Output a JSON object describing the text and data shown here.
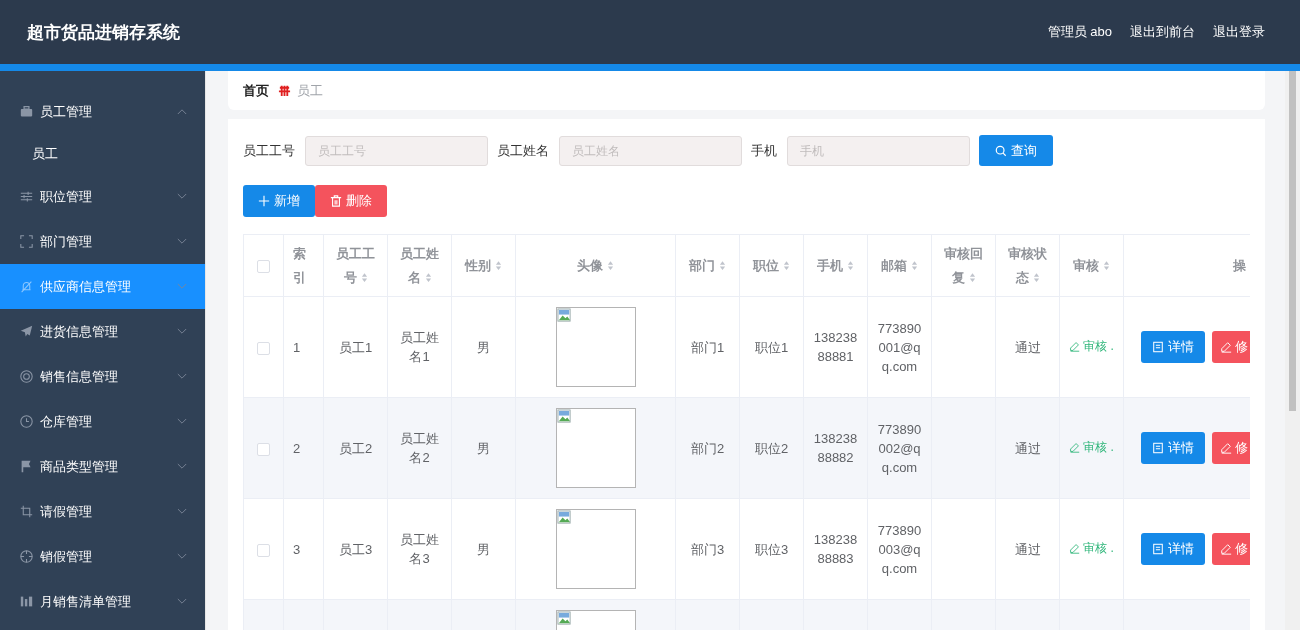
{
  "app_title": "超市货品进销存系统",
  "header_links": [
    "管理员 abo",
    "退出到前台",
    "退出登录"
  ],
  "sidebar": {
    "items": [
      {
        "label": "员工管理",
        "expanded": true,
        "selected": false,
        "children": [
          {
            "label": "员工",
            "selected": false
          }
        ]
      },
      {
        "label": "职位管理",
        "expanded": false,
        "selected": false
      },
      {
        "label": "部门管理",
        "expanded": false,
        "selected": false
      },
      {
        "label": "供应商信息管理",
        "expanded": false,
        "selected": true
      },
      {
        "label": "进货信息管理",
        "expanded": false,
        "selected": false
      },
      {
        "label": "销售信息管理",
        "expanded": false,
        "selected": false
      },
      {
        "label": "仓库管理",
        "expanded": false,
        "selected": false
      },
      {
        "label": "商品类型管理",
        "expanded": false,
        "selected": false
      },
      {
        "label": "请假管理",
        "expanded": false,
        "selected": false
      },
      {
        "label": "销假管理",
        "expanded": false,
        "selected": false
      },
      {
        "label": "月销售清单管理",
        "expanded": false,
        "selected": false
      }
    ]
  },
  "breadcrumb": [
    "首页",
    "员工"
  ],
  "search": {
    "fields": [
      {
        "label": "员工工号",
        "placeholder": "员工工号"
      },
      {
        "label": "员工姓名",
        "placeholder": "员工姓名"
      },
      {
        "label": "手机",
        "placeholder": "手机"
      }
    ],
    "button": "查询"
  },
  "actions": [
    {
      "kind": "add",
      "label": "新增"
    },
    {
      "kind": "delete",
      "label": "删除"
    }
  ],
  "table": {
    "header_checked": false,
    "columns": [
      {
        "label": "索引",
        "sortable": false
      },
      {
        "label": "员工工号",
        "sortable": true
      },
      {
        "label": "员工姓名",
        "sortable": true
      },
      {
        "label": "性别",
        "sortable": true
      },
      {
        "label": "头像",
        "sortable": true
      },
      {
        "label": "部门",
        "sortable": true
      },
      {
        "label": "职位",
        "sortable": true
      },
      {
        "label": "手机",
        "sortable": true
      },
      {
        "label": "邮箱",
        "sortable": true
      },
      {
        "label": "审核回复",
        "sortable": true
      },
      {
        "label": "审核状态",
        "sortable": true
      },
      {
        "label": "审核",
        "sortable": true
      },
      {
        "label": "操",
        "sortable": false
      }
    ],
    "rows": [
      {
        "checked": false,
        "index": "1",
        "employee_no": "员工1",
        "name": "员工姓名1",
        "gender": "男",
        "department": "部门1",
        "position": "职位1",
        "phone": "13823888881",
        "email": "773890001@qq.com",
        "audit_status": "通过",
        "audit_action": "审核 .",
        "buttons": [
          "详情",
          "修"
        ]
      },
      {
        "checked": false,
        "index": "2",
        "employee_no": "员工2",
        "name": "员工姓名2",
        "gender": "男",
        "department": "部门2",
        "position": "职位2",
        "phone": "13823888882",
        "email": "773890002@qq.com",
        "audit_status": "通过",
        "audit_action": "审核 .",
        "buttons": [
          "详情",
          "修"
        ]
      },
      {
        "checked": false,
        "index": "3",
        "employee_no": "员工3",
        "name": "员工姓名3",
        "gender": "男",
        "department": "部门3",
        "position": "职位3",
        "phone": "13823888883",
        "email": "773890003@qq.com",
        "audit_status": "通过",
        "audit_action": "审核 .",
        "buttons": [
          "详情",
          "修"
        ]
      },
      {}
    ]
  }
}
